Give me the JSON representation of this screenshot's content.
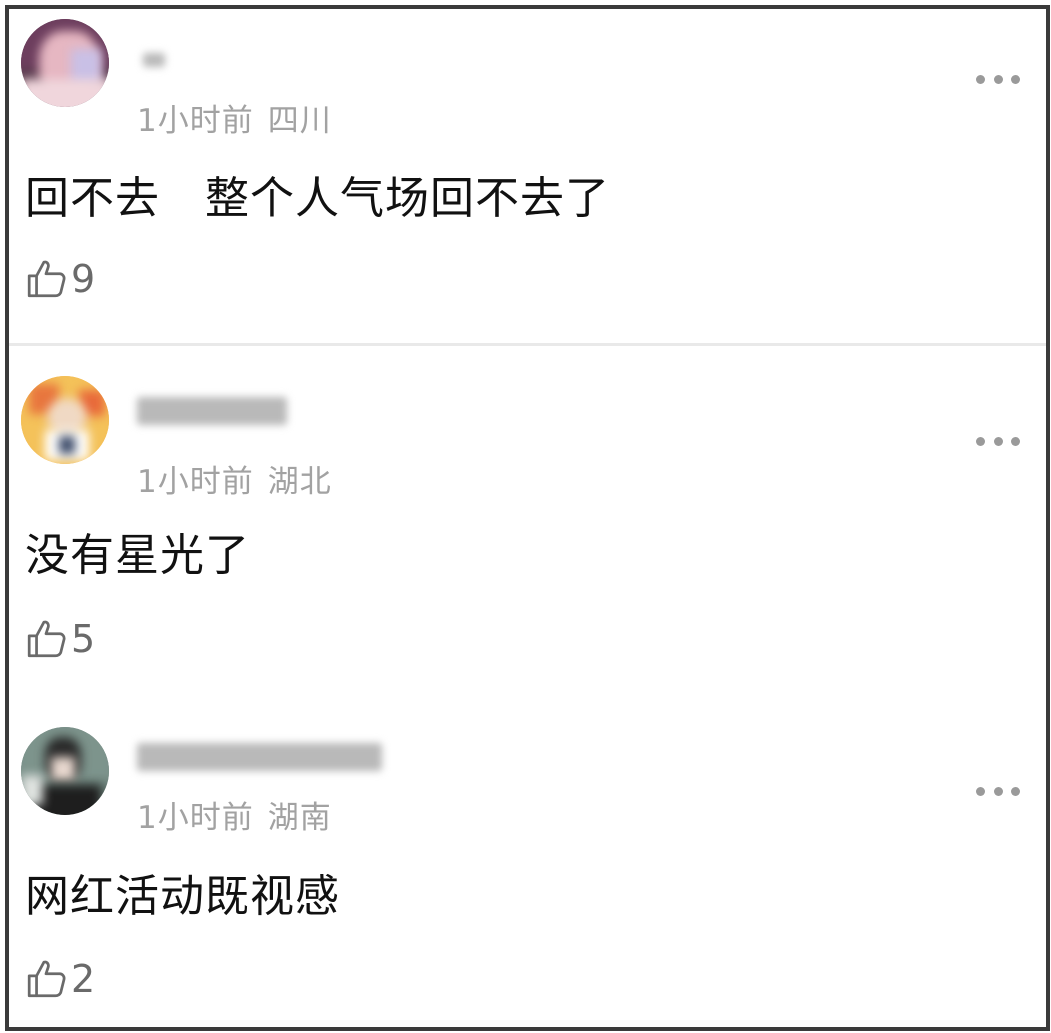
{
  "comments": [
    {
      "time": "1小时前",
      "location": "四川",
      "content": "回不去　整个人气场回不去了",
      "likes": "9",
      "avatar_icon": "user-avatar-icon"
    },
    {
      "time": "1小时前",
      "location": "湖北",
      "content": "没有星光了",
      "likes": "5",
      "avatar_icon": "user-avatar-icon"
    },
    {
      "time": "1小时前",
      "location": "湖南",
      "content": "网红活动既视感",
      "likes": "2",
      "avatar_icon": "user-avatar-icon"
    }
  ],
  "icons": {
    "like": "thumbs-up-icon",
    "more": "more-options-icon"
  },
  "colors": {
    "text_primary": "#111111",
    "text_meta": "#a2a2a2",
    "divider": "#e9e9e9",
    "frame_border": "#3a3a3a"
  }
}
